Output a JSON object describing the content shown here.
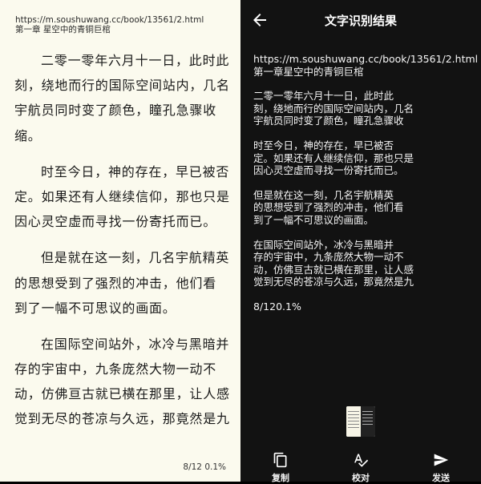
{
  "reader": {
    "url": "https://m.soushuwang.cc/book/13561/2.html",
    "chapter": "第一章 星空中的青铜巨棺",
    "paragraphs": [
      [
        "二零一零年六月十一日，此时此",
        "刻，绕地而行的国际空间站内，几名",
        "宇航员同时变了颜色，瞳孔急骤收",
        "缩。"
      ],
      [
        "时至今日，神的存在，早已被否",
        "定。如果还有人继续信仰，那也只是",
        "因心灵空虚而寻找一份寄托而已。"
      ],
      [
        "但是就在这一刻，几名宇航精英",
        "的思想受到了强烈的冲击，他们看",
        "到了一幅不可思议的画面。"
      ],
      [
        "在国际空间站外，冰冷与黑暗并",
        "存的宇宙中，九条庞然大物一动不",
        "动，仿佛亘古就已横在那里，让人感",
        "觉到无尽的苍凉与久远，那竟然是九"
      ]
    ],
    "page_info": "8/12  0.1%"
  },
  "ocr": {
    "title": "文字识别结果",
    "url": "https://m.soushuwang.cc/book/13561/2.html",
    "chapter": "第一章星空中的青铜巨棺",
    "paragraphs": [
      [
        "二零一零年六月十一日，此时此",
        "刻，绕地而行的国际空间站内，几名",
        "宇航员同时变了颜色，瞳孔急骤收"
      ],
      [
        "时至今日，神的存在，早已被否",
        "定。如果还有人继续信仰，那也只是",
        "因心灵空虚而寻找一份寄托而已。"
      ],
      [
        "但是就在这一刻，几名宇航精英",
        "的思想受到了强烈的冲击，他们看",
        "到了一幅不可思议的画面。"
      ],
      [
        "在国际空间站外，冰冷与黑暗并",
        "存的宇宙中，九条庞然大物一动不",
        "动，仿佛亘古就已横在那里，让人感",
        "觉到无尽的苍凉与久远，那竟然是九"
      ]
    ],
    "footer_text": "8/120.1%",
    "toolbar": {
      "copy_label": "复制",
      "proofread_label": "校对",
      "send_label": "发送"
    },
    "icons": {
      "back": "arrow-left-icon",
      "copy": "copy-icon",
      "proofread": "spellcheck-icon",
      "send": "send-icon"
    },
    "colors": {
      "reader_bg": "#fbfaee",
      "ocr_bg": "#121212",
      "text_dark": "#1a1a1a",
      "text_light": "#f2f2f2"
    }
  }
}
